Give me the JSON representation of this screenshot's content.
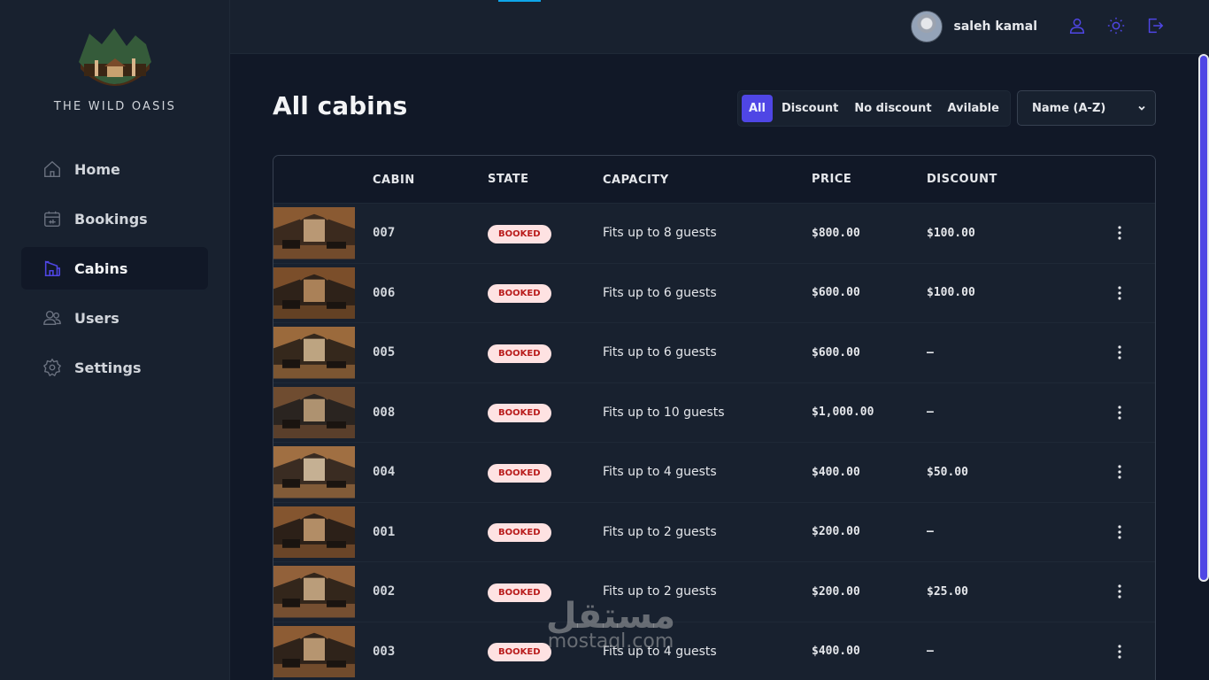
{
  "app": {
    "brand": "THE WILD OASIS"
  },
  "sidebar": {
    "items": [
      {
        "label": "Home",
        "icon": "home-icon",
        "active": false
      },
      {
        "label": "Bookings",
        "icon": "calendar-icon",
        "active": false
      },
      {
        "label": "Cabins",
        "icon": "cabin-icon",
        "active": true
      },
      {
        "label": "Users",
        "icon": "users-icon",
        "active": false
      },
      {
        "label": "Settings",
        "icon": "gear-icon",
        "active": false
      }
    ]
  },
  "header": {
    "user_name": "saleh kamal",
    "icons": [
      "user-icon",
      "sun-icon",
      "logout-icon"
    ]
  },
  "page": {
    "title": "All cabins",
    "filters": [
      {
        "label": "All",
        "active": true
      },
      {
        "label": "Discount",
        "active": false
      },
      {
        "label": "No discount",
        "active": false
      },
      {
        "label": "Avilable",
        "active": false
      }
    ],
    "sort": {
      "selected": "Name (A-Z)"
    }
  },
  "table": {
    "columns": [
      "",
      "CABIN",
      "STATE",
      "CAPACITY",
      "PRICE",
      "DISCOUNT",
      ""
    ],
    "rows": [
      {
        "cabin": "007",
        "state": "BOOKED",
        "capacity": "Fits up to 8 guests",
        "price": "$800.00",
        "discount": "$100.00"
      },
      {
        "cabin": "006",
        "state": "BOOKED",
        "capacity": "Fits up to 6 guests",
        "price": "$600.00",
        "discount": "$100.00"
      },
      {
        "cabin": "005",
        "state": "BOOKED",
        "capacity": "Fits up to 6 guests",
        "price": "$600.00",
        "discount": "—"
      },
      {
        "cabin": "008",
        "state": "BOOKED",
        "capacity": "Fits up to 10 guests",
        "price": "$1,000.00",
        "discount": "—"
      },
      {
        "cabin": "004",
        "state": "BOOKED",
        "capacity": "Fits up to 4 guests",
        "price": "$400.00",
        "discount": "$50.00"
      },
      {
        "cabin": "001",
        "state": "BOOKED",
        "capacity": "Fits up to 2 guests",
        "price": "$200.00",
        "discount": "—"
      },
      {
        "cabin": "002",
        "state": "BOOKED",
        "capacity": "Fits up to 2 guests",
        "price": "$200.00",
        "discount": "$25.00"
      },
      {
        "cabin": "003",
        "state": "BOOKED",
        "capacity": "Fits up to 4 guests",
        "price": "$400.00",
        "discount": "—"
      }
    ]
  },
  "watermark": {
    "arabic": "مستقل",
    "latin": "mostaql.com"
  },
  "colors": {
    "accent": "#4f46e5",
    "badge_bg": "#fee2e2",
    "badge_text": "#b91c1c"
  }
}
